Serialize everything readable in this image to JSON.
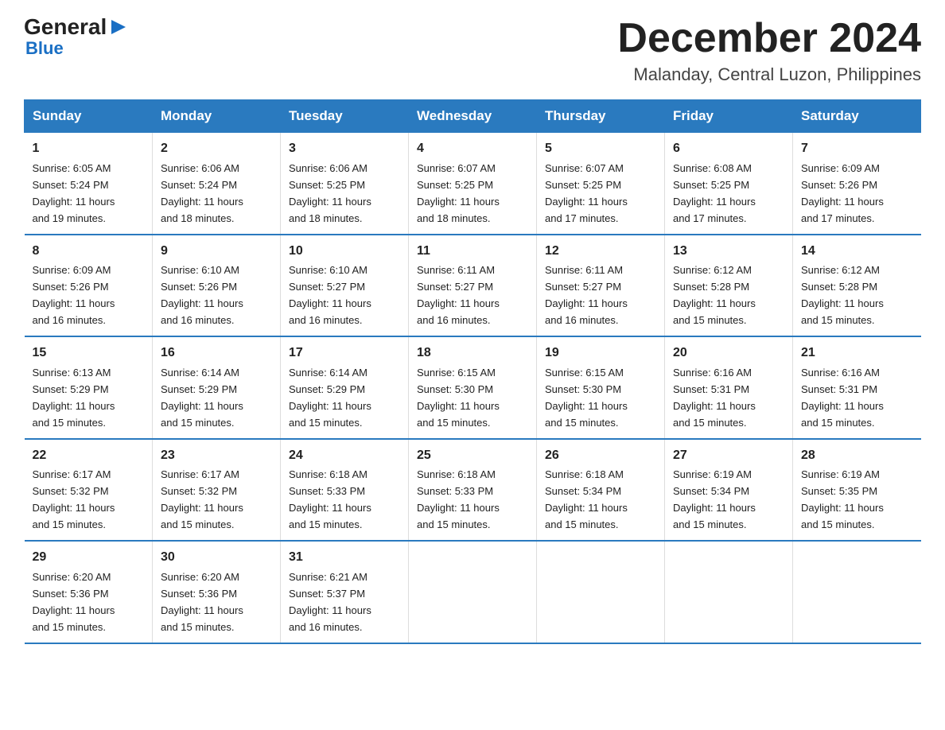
{
  "header": {
    "logo": {
      "general": "General",
      "arrow": "▶",
      "blue": "Blue"
    },
    "title": "December 2024",
    "location": "Malanday, Central Luzon, Philippines"
  },
  "days_of_week": [
    "Sunday",
    "Monday",
    "Tuesday",
    "Wednesday",
    "Thursday",
    "Friday",
    "Saturday"
  ],
  "weeks": [
    [
      {
        "day": "1",
        "sunrise": "6:05 AM",
        "sunset": "5:24 PM",
        "daylight": "11 hours and 19 minutes."
      },
      {
        "day": "2",
        "sunrise": "6:06 AM",
        "sunset": "5:24 PM",
        "daylight": "11 hours and 18 minutes."
      },
      {
        "day": "3",
        "sunrise": "6:06 AM",
        "sunset": "5:25 PM",
        "daylight": "11 hours and 18 minutes."
      },
      {
        "day": "4",
        "sunrise": "6:07 AM",
        "sunset": "5:25 PM",
        "daylight": "11 hours and 18 minutes."
      },
      {
        "day": "5",
        "sunrise": "6:07 AM",
        "sunset": "5:25 PM",
        "daylight": "11 hours and 17 minutes."
      },
      {
        "day": "6",
        "sunrise": "6:08 AM",
        "sunset": "5:25 PM",
        "daylight": "11 hours and 17 minutes."
      },
      {
        "day": "7",
        "sunrise": "6:09 AM",
        "sunset": "5:26 PM",
        "daylight": "11 hours and 17 minutes."
      }
    ],
    [
      {
        "day": "8",
        "sunrise": "6:09 AM",
        "sunset": "5:26 PM",
        "daylight": "11 hours and 16 minutes."
      },
      {
        "day": "9",
        "sunrise": "6:10 AM",
        "sunset": "5:26 PM",
        "daylight": "11 hours and 16 minutes."
      },
      {
        "day": "10",
        "sunrise": "6:10 AM",
        "sunset": "5:27 PM",
        "daylight": "11 hours and 16 minutes."
      },
      {
        "day": "11",
        "sunrise": "6:11 AM",
        "sunset": "5:27 PM",
        "daylight": "11 hours and 16 minutes."
      },
      {
        "day": "12",
        "sunrise": "6:11 AM",
        "sunset": "5:27 PM",
        "daylight": "11 hours and 16 minutes."
      },
      {
        "day": "13",
        "sunrise": "6:12 AM",
        "sunset": "5:28 PM",
        "daylight": "11 hours and 15 minutes."
      },
      {
        "day": "14",
        "sunrise": "6:12 AM",
        "sunset": "5:28 PM",
        "daylight": "11 hours and 15 minutes."
      }
    ],
    [
      {
        "day": "15",
        "sunrise": "6:13 AM",
        "sunset": "5:29 PM",
        "daylight": "11 hours and 15 minutes."
      },
      {
        "day": "16",
        "sunrise": "6:14 AM",
        "sunset": "5:29 PM",
        "daylight": "11 hours and 15 minutes."
      },
      {
        "day": "17",
        "sunrise": "6:14 AM",
        "sunset": "5:29 PM",
        "daylight": "11 hours and 15 minutes."
      },
      {
        "day": "18",
        "sunrise": "6:15 AM",
        "sunset": "5:30 PM",
        "daylight": "11 hours and 15 minutes."
      },
      {
        "day": "19",
        "sunrise": "6:15 AM",
        "sunset": "5:30 PM",
        "daylight": "11 hours and 15 minutes."
      },
      {
        "day": "20",
        "sunrise": "6:16 AM",
        "sunset": "5:31 PM",
        "daylight": "11 hours and 15 minutes."
      },
      {
        "day": "21",
        "sunrise": "6:16 AM",
        "sunset": "5:31 PM",
        "daylight": "11 hours and 15 minutes."
      }
    ],
    [
      {
        "day": "22",
        "sunrise": "6:17 AM",
        "sunset": "5:32 PM",
        "daylight": "11 hours and 15 minutes."
      },
      {
        "day": "23",
        "sunrise": "6:17 AM",
        "sunset": "5:32 PM",
        "daylight": "11 hours and 15 minutes."
      },
      {
        "day": "24",
        "sunrise": "6:18 AM",
        "sunset": "5:33 PM",
        "daylight": "11 hours and 15 minutes."
      },
      {
        "day": "25",
        "sunrise": "6:18 AM",
        "sunset": "5:33 PM",
        "daylight": "11 hours and 15 minutes."
      },
      {
        "day": "26",
        "sunrise": "6:18 AM",
        "sunset": "5:34 PM",
        "daylight": "11 hours and 15 minutes."
      },
      {
        "day": "27",
        "sunrise": "6:19 AM",
        "sunset": "5:34 PM",
        "daylight": "11 hours and 15 minutes."
      },
      {
        "day": "28",
        "sunrise": "6:19 AM",
        "sunset": "5:35 PM",
        "daylight": "11 hours and 15 minutes."
      }
    ],
    [
      {
        "day": "29",
        "sunrise": "6:20 AM",
        "sunset": "5:36 PM",
        "daylight": "11 hours and 15 minutes."
      },
      {
        "day": "30",
        "sunrise": "6:20 AM",
        "sunset": "5:36 PM",
        "daylight": "11 hours and 15 minutes."
      },
      {
        "day": "31",
        "sunrise": "6:21 AM",
        "sunset": "5:37 PM",
        "daylight": "11 hours and 16 minutes."
      },
      null,
      null,
      null,
      null
    ]
  ]
}
